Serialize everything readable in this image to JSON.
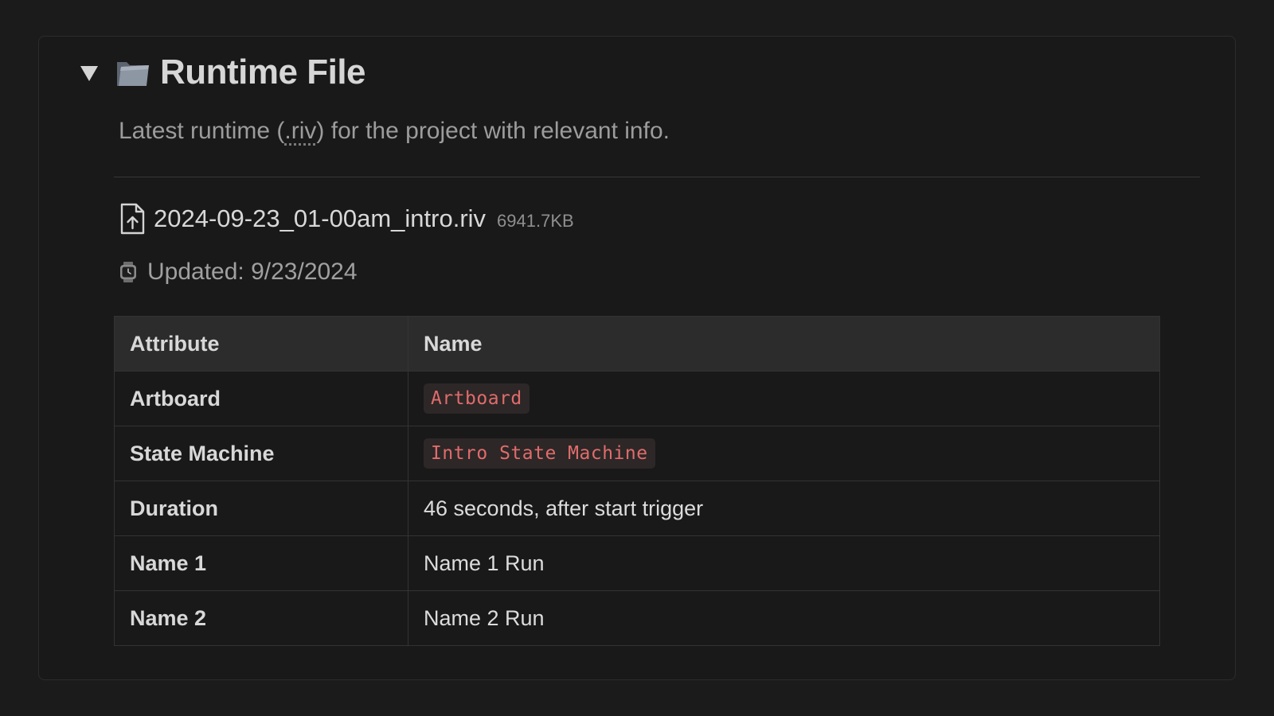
{
  "section": {
    "title": "Runtime File",
    "folder_icon": "folder-icon",
    "description_prefix": "Latest runtime (",
    "description_riv": ".riv",
    "description_suffix": ") for the project with relevant info."
  },
  "file": {
    "name": "2024-09-23_01-00am_intro.riv",
    "size": "6941.7KB",
    "icon": "file-upload-icon"
  },
  "updated": {
    "text": "Updated: 9/23/2024",
    "icon": "watch-icon"
  },
  "table": {
    "headers": [
      "Attribute",
      "Name"
    ],
    "rows": [
      {
        "attribute": "Artboard",
        "value": "Artboard",
        "code": true
      },
      {
        "attribute": "State Machine",
        "value": "Intro State Machine",
        "code": true
      },
      {
        "attribute": "Duration",
        "value": "46 seconds, after start trigger",
        "code": false
      },
      {
        "attribute": "Name 1",
        "value": "Name 1 Run",
        "code": false
      },
      {
        "attribute": "Name 2",
        "value": "Name 2 Run",
        "code": false
      }
    ]
  },
  "colors": {
    "background": "#1b1b1b",
    "code_text": "#e06c6c",
    "code_bg": "#2d2727",
    "header_bg": "#2c2c2c"
  }
}
